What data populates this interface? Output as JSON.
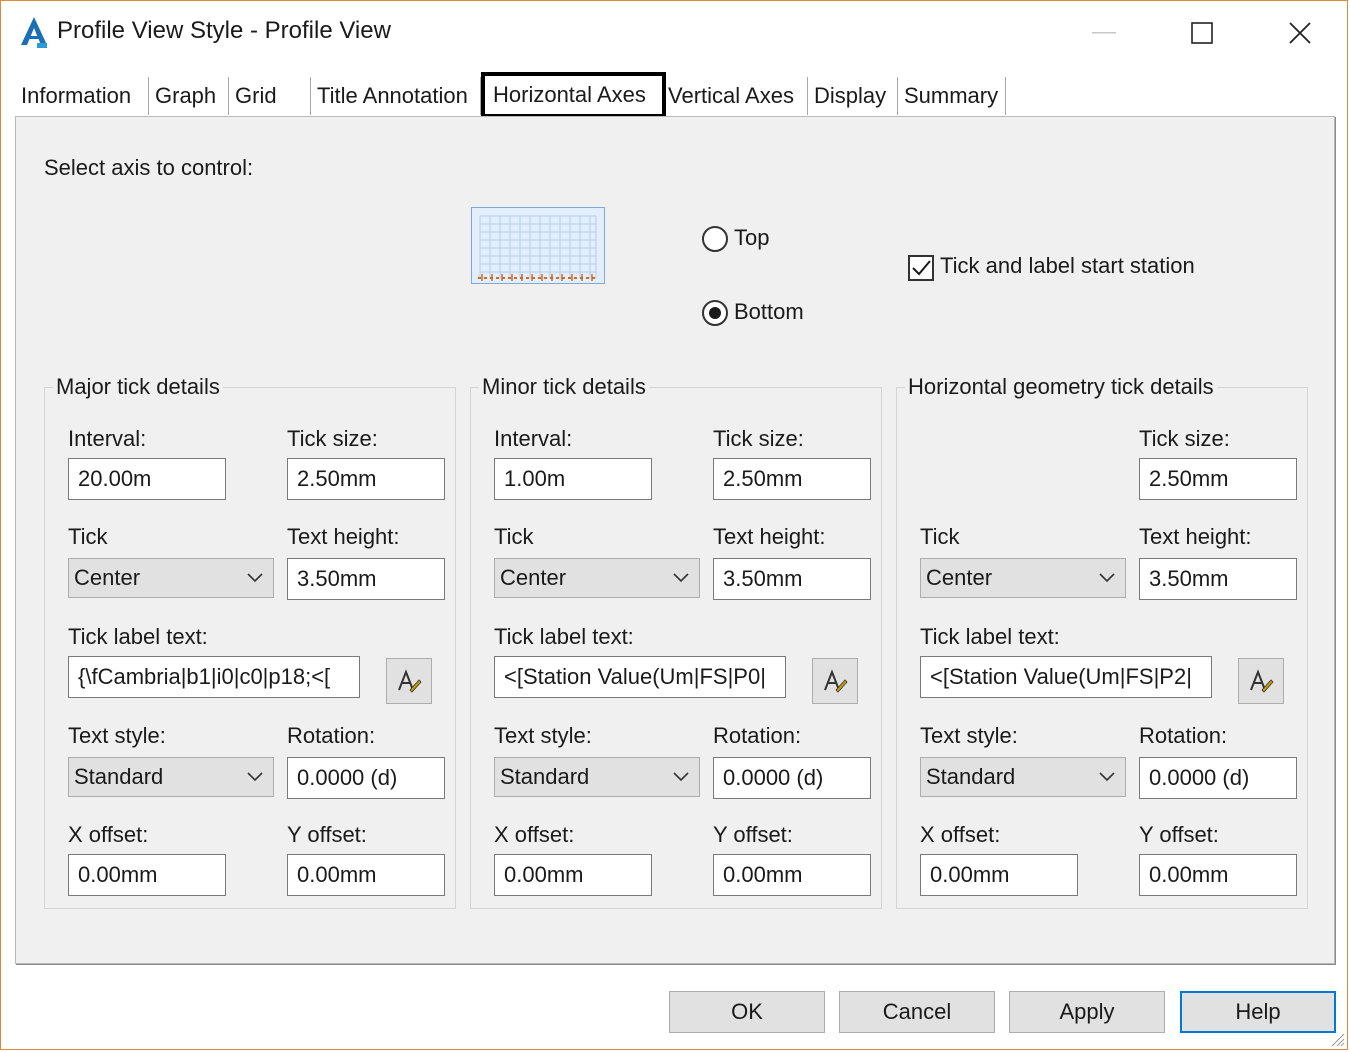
{
  "window": {
    "title": "Profile View Style - Profile View"
  },
  "tabs": [
    {
      "label": "Information"
    },
    {
      "label": "Graph"
    },
    {
      "label": "Grid"
    },
    {
      "label": "Title Annotation"
    },
    {
      "label": "Horizontal Axes",
      "active": true
    },
    {
      "label": "Vertical Axes"
    },
    {
      "label": "Display"
    },
    {
      "label": "Summary"
    }
  ],
  "axis_select": {
    "label": "Select axis to control:",
    "options": [
      "Top",
      "Bottom"
    ],
    "selected": "Bottom",
    "start_station_label": "Tick and label start station",
    "start_station_checked": true
  },
  "major": {
    "title": "Major tick details",
    "interval_label": "Interval:",
    "interval": "20.00m",
    "tick_size_label": "Tick size:",
    "tick_size": "2.50mm",
    "tick_label": "Tick",
    "tick": "Center",
    "text_height_label": "Text height:",
    "text_height": "3.50mm",
    "tick_label_text_label": "Tick label text:",
    "tick_label_text": "{\\fCambria|b1|i0|c0|p18;<[",
    "text_style_label": "Text style:",
    "text_style": "Standard",
    "rotation_label": "Rotation:",
    "rotation": "0.0000 (d)",
    "x_offset_label": "X offset:",
    "x_offset": "0.00mm",
    "y_offset_label": "Y offset:",
    "y_offset": "0.00mm"
  },
  "minor": {
    "title": "Minor tick details",
    "interval_label": "Interval:",
    "interval": "1.00m",
    "tick_size_label": "Tick size:",
    "tick_size": "2.50mm",
    "tick_label": "Tick",
    "tick": "Center",
    "text_height_label": "Text height:",
    "text_height": "3.50mm",
    "tick_label_text_label": "Tick label text:",
    "tick_label_text": "<[Station Value(Um|FS|P0|",
    "text_style_label": "Text style:",
    "text_style": "Standard",
    "rotation_label": "Rotation:",
    "rotation": "0.0000 (d)",
    "x_offset_label": "X offset:",
    "x_offset": "0.00mm",
    "y_offset_label": "Y offset:",
    "y_offset": "0.00mm"
  },
  "geometry": {
    "title": "Horizontal geometry tick details",
    "tick_size_label": "Tick size:",
    "tick_size": "2.50mm",
    "tick_label": "Tick",
    "tick": "Center",
    "text_height_label": "Text height:",
    "text_height": "3.50mm",
    "tick_label_text_label": "Tick label text:",
    "tick_label_text": "<[Station Value(Um|FS|P2|",
    "text_style_label": "Text style:",
    "text_style": "Standard",
    "rotation_label": "Rotation:",
    "rotation": "0.0000 (d)",
    "x_offset_label": "X offset:",
    "x_offset": "0.00mm",
    "y_offset_label": "Y offset:",
    "y_offset": "0.00mm"
  },
  "buttons": {
    "ok": "OK",
    "cancel": "Cancel",
    "apply": "Apply",
    "help": "Help"
  },
  "colors": {
    "window_border": "#e08a3c",
    "panel_bg": "#f0f0f0",
    "default_button_border": "#0078d7",
    "preview_bg": "#e3eefc",
    "preview_ticks": "#d2691e"
  },
  "icons": {
    "app": "autocad-civil-icon",
    "minimize": "minimize-icon",
    "maximize": "maximize-icon",
    "close": "close-icon",
    "picker": "text-component-editor-icon"
  }
}
